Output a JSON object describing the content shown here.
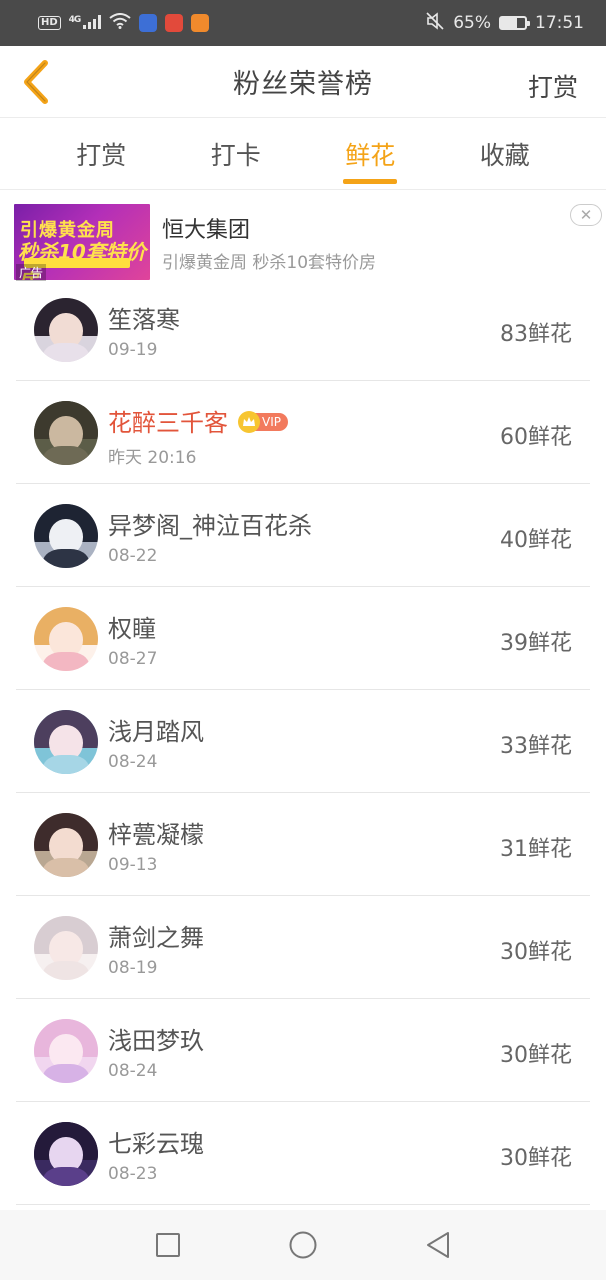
{
  "status_bar": {
    "left_badge": "HD",
    "network": "4G",
    "battery": "65%",
    "battery_level": 0.65,
    "time": "17:51",
    "icons": [
      "wifi-icon",
      "shield-app-icon",
      "weibo-app-icon",
      "video-app-icon",
      "mute-icon"
    ]
  },
  "header": {
    "title": "粉丝荣誉榜",
    "action": "打赏",
    "back_icon": "chevron-left-icon"
  },
  "tabs": [
    {
      "label": "打赏",
      "active": false
    },
    {
      "label": "打卡",
      "active": false
    },
    {
      "label": "鲜花",
      "active": true
    },
    {
      "label": "收藏",
      "active": false
    }
  ],
  "ad": {
    "title": "恒大集团",
    "description": "引爆黄金周 秒杀10套特价房",
    "label": "广告",
    "image_text_1": "引爆黄金周",
    "image_text_2": "秒杀10套特价房",
    "close_icon": "close-icon"
  },
  "list": [
    {
      "name": "笙落寒",
      "date": "09-19",
      "amount": "83鲜花",
      "vip": false,
      "colors": {
        "hair": "#2b2430",
        "face": "#f1dcd4",
        "body": "#e8e0ea",
        "bg": "#d9d4de"
      }
    },
    {
      "name": "花醉三千客",
      "date": "昨天 20:16",
      "amount": "60鲜花",
      "vip": true,
      "vip_label": "VIP",
      "colors": {
        "hair": "#3d3a2e",
        "face": "#cbb8a0",
        "body": "#6e6a55",
        "bg": "#5c5d48"
      }
    },
    {
      "name": "异梦阁_神泣百花杀",
      "date": "08-22",
      "amount": "40鲜花",
      "vip": false,
      "colors": {
        "hair": "#1e2433",
        "face": "#eef0f4",
        "body": "#2d3445",
        "bg": "#aab2c2"
      }
    },
    {
      "name": "权瞳",
      "date": "08-27",
      "amount": "39鲜花",
      "vip": false,
      "colors": {
        "hair": "#e9b064",
        "face": "#fbe6da",
        "body": "#f3b7c2",
        "bg": "#fdf1ea"
      }
    },
    {
      "name": "浅月踏风",
      "date": "08-24",
      "amount": "33鲜花",
      "vip": false,
      "colors": {
        "hair": "#4d3f5e",
        "face": "#f5e3e8",
        "body": "#a6d6e6",
        "bg": "#7fc4d8"
      }
    },
    {
      "name": "梓甍凝檬",
      "date": "09-13",
      "amount": "31鲜花",
      "vip": false,
      "colors": {
        "hair": "#3e2c2c",
        "face": "#f3dcd0",
        "body": "#d9bfa8",
        "bg": "#b9a792"
      }
    },
    {
      "name": "萧剑之舞",
      "date": "08-19",
      "amount": "30鲜花",
      "vip": false,
      "colors": {
        "hair": "#d8cdd2",
        "face": "#f7e8e6",
        "body": "#efe4e4",
        "bg": "#f6f0f0"
      }
    },
    {
      "name": "浅田梦玖",
      "date": "08-24",
      "amount": "30鲜花",
      "vip": false,
      "colors": {
        "hair": "#e8b6dc",
        "face": "#fbe8f1",
        "body": "#d7b2e6",
        "bg": "#f1d6ef"
      }
    },
    {
      "name": "七彩云瑰",
      "date": "08-23",
      "amount": "30鲜花",
      "vip": false,
      "colors": {
        "hair": "#241a3a",
        "face": "#e7d6f0",
        "body": "#5a3f8a",
        "bg": "#3a2a60"
      }
    }
  ],
  "nav_bar": {
    "icons": [
      "recent-apps-icon",
      "home-icon",
      "back-icon"
    ]
  },
  "accent_color": "#f4a317",
  "vip_name_color": "#e2553b"
}
